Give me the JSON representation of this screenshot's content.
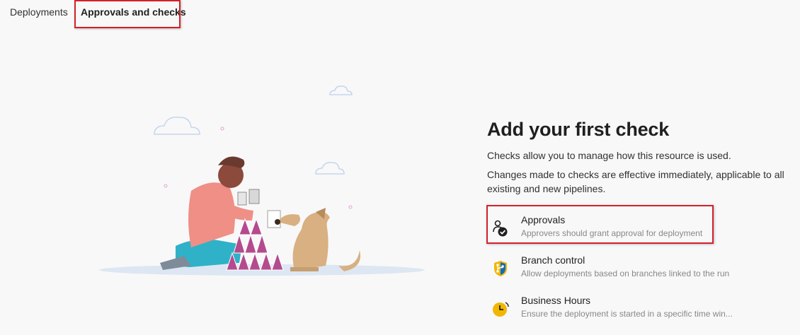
{
  "tabs": [
    {
      "label": "Deployments"
    },
    {
      "label": "Approvals and checks"
    }
  ],
  "empty_state": {
    "title": "Add your first check",
    "line1": "Checks allow you to manage how this resource is used.",
    "line2": "Changes made to checks are effective immediately, applicable to all existing and new pipelines."
  },
  "checks": [
    {
      "name": "Approvals",
      "description": "Approvers should grant approval for deployment",
      "icon": "approvals-icon"
    },
    {
      "name": "Branch control",
      "description": "Allow deployments based on branches linked to the run",
      "icon": "branch-control-icon"
    },
    {
      "name": "Business Hours",
      "description": "Ensure the deployment is started in a specific time win...",
      "icon": "business-hours-icon"
    }
  ],
  "colors": {
    "highlight": "#d4202a",
    "background": "#f8f8f8",
    "branch_blue": "#0f6cbd",
    "hours_yellow": "#f2b600"
  }
}
